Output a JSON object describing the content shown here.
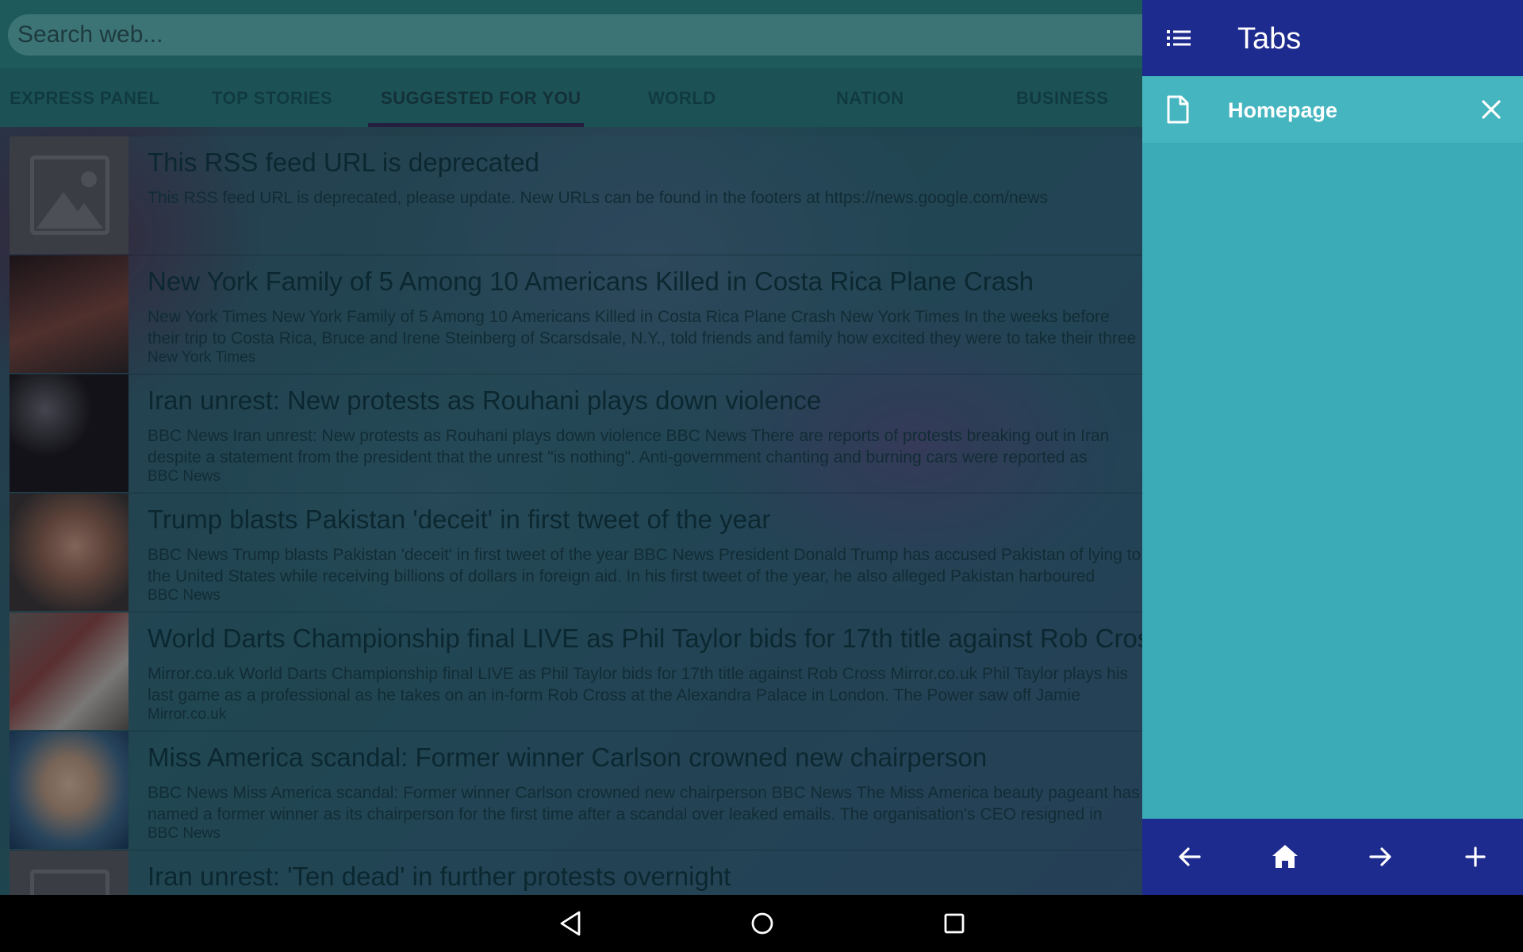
{
  "search": {
    "placeholder": "Search web..."
  },
  "categories": [
    {
      "label": "EXPRESS PANEL"
    },
    {
      "label": "TOP STORIES"
    },
    {
      "label": "SUGGESTED FOR YOU",
      "active": true
    },
    {
      "label": "WORLD"
    },
    {
      "label": "NATION"
    },
    {
      "label": "BUSINESS"
    }
  ],
  "feed": [
    {
      "title": "This RSS feed URL is deprecated",
      "desc": "This RSS feed URL is deprecated, please update. New URLs can be found in the footers at https://news.google.com/news",
      "source": ""
    },
    {
      "title": "New York Family of 5 Among 10 Americans Killed in Costa Rica Plane Crash",
      "desc": "New York Times New York Family of 5 Among 10 Americans Killed in Costa Rica Plane Crash New York Times In the weeks before their trip to Costa Rica, Bruce and Irene Steinberg of Scarsdsale, N.Y., told friends and family how excited they were to take their three sons",
      "source": "New York Times"
    },
    {
      "title": "Iran unrest: New protests as Rouhani plays down violence",
      "desc": "BBC News Iran unrest: New protests as Rouhani plays down violence BBC News There are reports of protests breaking out in Iran despite a statement from the president that the unrest \"is nothing\". Anti-government chanting and burning cars were reported as",
      "source": "BBC News"
    },
    {
      "title": "Trump blasts Pakistan 'deceit' in first tweet of the year",
      "desc": "BBC News Trump blasts Pakistan 'deceit' in first tweet of the year BBC News President Donald Trump has accused Pakistan of lying to the United States while receiving billions of dollars in foreign aid. In his first tweet of the year, he also alleged Pakistan harboured",
      "source": "BBC News"
    },
    {
      "title": "World Darts Championship final LIVE as Phil Taylor bids for 17th title against Rob Cross",
      "desc": "Mirror.co.uk World Darts Championship final LIVE as Phil Taylor bids for 17th title against Rob Cross Mirror.co.uk Phil Taylor plays his last game as a professional as he takes on an in-form Rob Cross at the Alexandra Palace in London. The Power saw off Jamie",
      "source": "Mirror.co.uk"
    },
    {
      "title": "Miss America scandal: Former winner Carlson crowned new chairperson",
      "desc": "BBC News Miss America scandal: Former winner Carlson crowned new chairperson BBC News The Miss America beauty pageant has named a former winner as its chairperson for the first time after a scandal over leaked emails. The organisation's CEO resigned in December after",
      "source": "BBC News"
    },
    {
      "title": "Iran unrest: 'Ten dead' in further protests overnight",
      "desc": "",
      "source": ""
    }
  ],
  "drawer": {
    "title": "Tabs",
    "tabs": [
      {
        "label": "Homepage"
      }
    ]
  },
  "icons": {
    "menu": "list-icon",
    "tab_page": "file-icon",
    "close": "close-icon",
    "back": "arrow-left-icon",
    "home": "home-icon",
    "forward": "arrow-right-icon",
    "add": "plus-icon"
  },
  "colors": {
    "drawer_header": "#1d2a8e",
    "drawer_body": "#3aabb7",
    "tab_entry": "#45b5bf",
    "toolbar": "#2f8a8c"
  }
}
